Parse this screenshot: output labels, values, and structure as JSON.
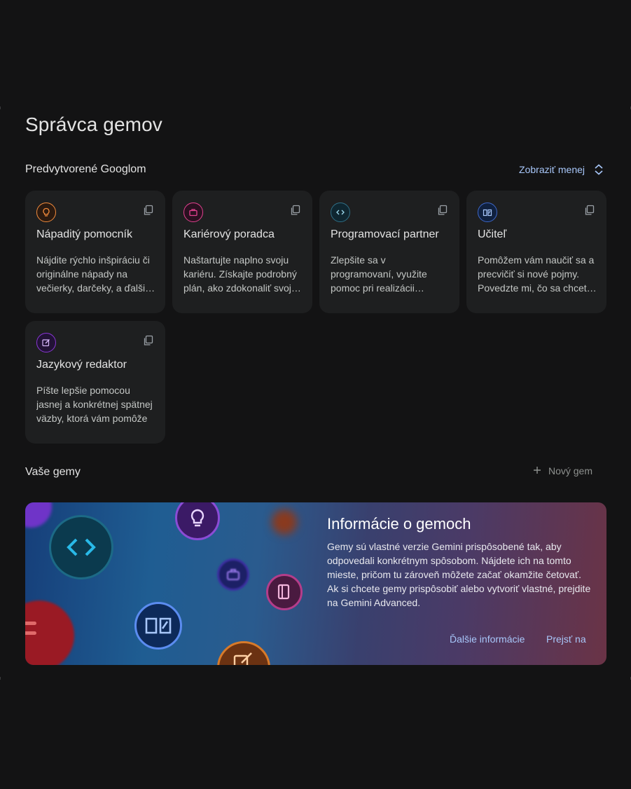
{
  "page": {
    "title": "Správca gemov"
  },
  "premade": {
    "heading": "Predvytvorené Googlom",
    "toggle_label": "Zobraziť menej",
    "gems": [
      {
        "name": "Nápaditý pomocník",
        "description": "Nájdite rýchlo inšpiráciu či originálne nápady na večierky, darčeky, a ďalšie príležitosti",
        "icon": "lightbulb-icon",
        "color": "#f28b3c"
      },
      {
        "name": "Kariérový poradca",
        "description": "Naštartujte naplno svoju kariéru. Získajte podrobný plán, ako zdokonaliť svoje zručnosti",
        "icon": "briefcase-icon",
        "color": "#e2418f"
      },
      {
        "name": "Programovací partner",
        "description": "Zlepšite sa v programovaní, využite pomoc pri realizácii projektov",
        "icon": "code-icon",
        "color": "#4fb6d8"
      },
      {
        "name": "Učiteľ",
        "description": "Pomôžem vám naučiť sa a precvičiť si nové pojmy. Povedzte mi, čo sa chcete naučiť",
        "icon": "book-icon",
        "color": "#5b8cf0"
      },
      {
        "name": "Jazykový redaktor",
        "description": "Píšte lepšie pomocou jasnej a konkrétnej spätnej väzby, ktorá vám pomôže",
        "icon": "edit-icon",
        "color": "#a64ae8"
      }
    ]
  },
  "yours": {
    "heading": "Vaše gemy",
    "new_gem_label": "Nový gem"
  },
  "info_banner": {
    "title": "Informácie o gemoch",
    "text": "Gemy sú vlastné verzie Gemini prispôsobené tak, aby odpovedali konkrétnym spôsobom. Nájdete ich na tomto mieste, pričom tu zároveň môžete začať okamžite četovať. Ak si chcete gemy prispôsobiť alebo vytvoriť vlastné, prejdite na Gemini Advanced.",
    "learn_more_label": "Ďalšie informácie",
    "go_label": "Prejsť na"
  }
}
